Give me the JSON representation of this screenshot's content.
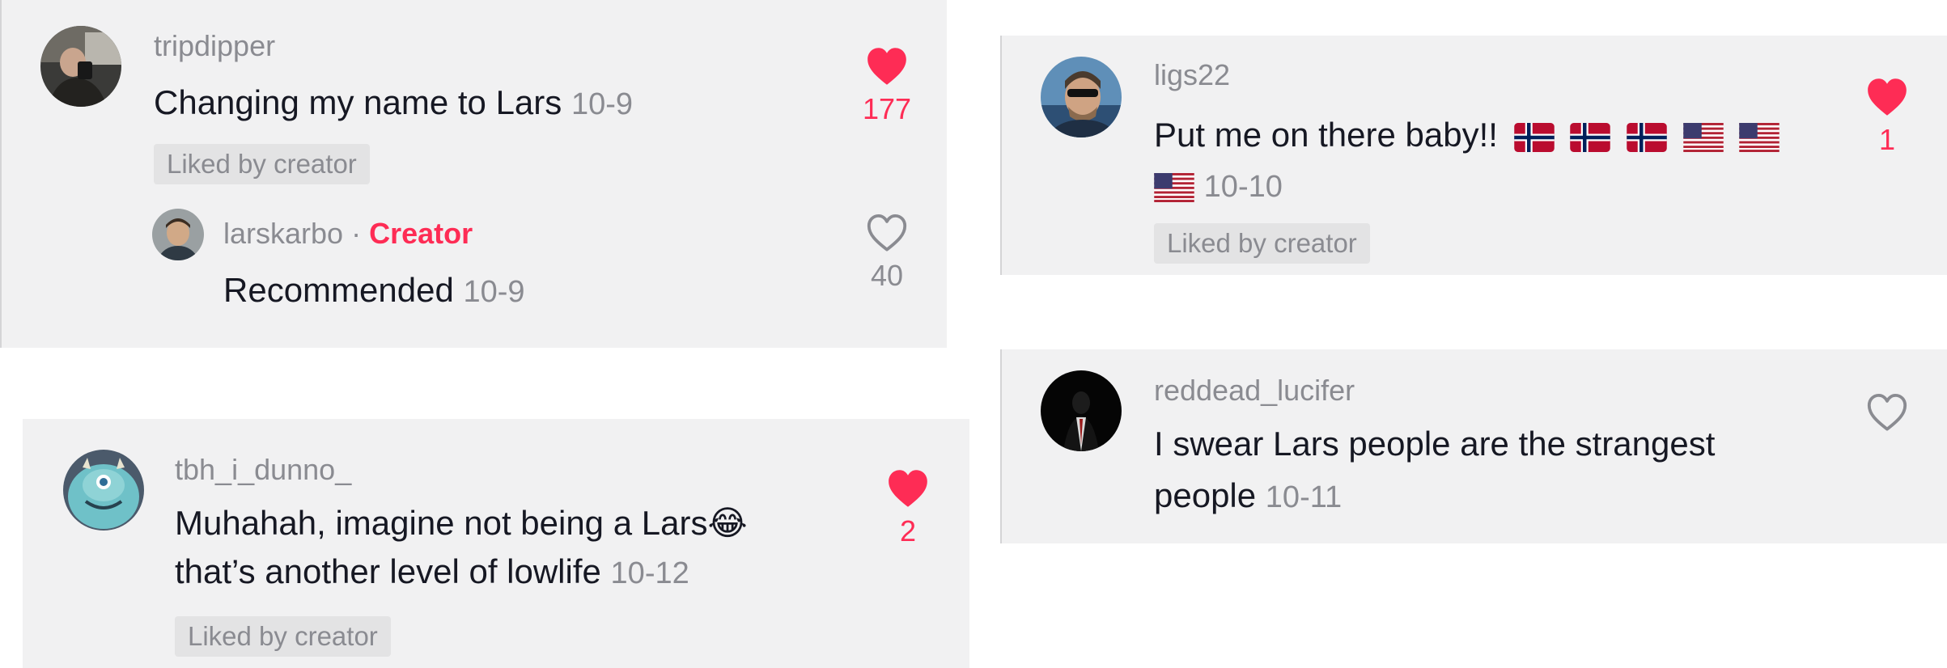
{
  "comments": [
    {
      "username": "tripdipper",
      "text": "Changing my name to Lars",
      "date": "10-9",
      "badge": "Liked by creator",
      "likes": "177",
      "liked": true,
      "reply": {
        "username": "larskarbo",
        "separator": "·",
        "creator_label": "Creator",
        "text": "Recommended",
        "date": "10-9",
        "likes": "40",
        "liked": false
      }
    },
    {
      "username": "ligs22",
      "text_line1": "Put me on there baby!!",
      "date": "10-10",
      "badge": "Liked by creator",
      "likes": "1",
      "liked": true,
      "flags": [
        "norway",
        "norway",
        "norway",
        "usa",
        "usa",
        "usa"
      ]
    },
    {
      "username": "tbh_i_dunno_",
      "text_line1": "Muhahah, imagine not being a Lars😂",
      "text_line2": "that’s another level of lowlife",
      "date": "10-12",
      "badge": "Liked by creator",
      "likes": "2",
      "liked": true
    },
    {
      "username": "reddead_lucifer",
      "text_line1": "I swear Lars people are the strangest",
      "text_line2": "people",
      "date": "10-11",
      "liked": false
    }
  ],
  "colors": {
    "like_red": "#fe2c55",
    "muted": "#8a8b91",
    "text": "#161823",
    "card_bg": "#f1f1f2"
  }
}
